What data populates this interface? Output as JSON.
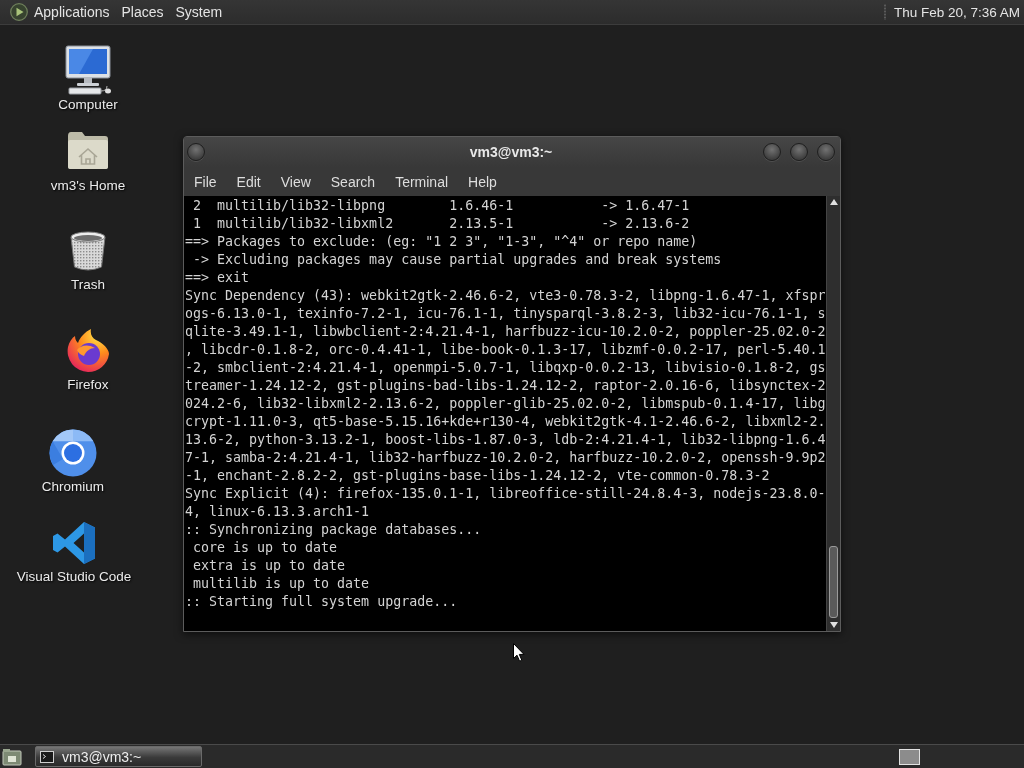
{
  "top_panel": {
    "menus": [
      "Applications",
      "Places",
      "System"
    ],
    "clock": "Thu Feb 20, 7:36 AM"
  },
  "desktop_icons": [
    {
      "kind": "computer",
      "label": "Computer"
    },
    {
      "kind": "home",
      "label": "vm3's Home"
    },
    {
      "kind": "trash",
      "label": "Trash"
    },
    {
      "kind": "firefox",
      "label": "Firefox"
    },
    {
      "kind": "chromium",
      "label": "Chromium"
    },
    {
      "kind": "vscode",
      "label": "Visual Studio Code"
    }
  ],
  "terminal_window": {
    "title": "vm3@vm3:~",
    "menu": [
      "File",
      "Edit",
      "View",
      "Search",
      "Terminal",
      "Help"
    ],
    "lines": [
      " 2  multilib/lib32-libpng        1.6.46-1           -> 1.6.47-1",
      " 1  multilib/lib32-libxml2       2.13.5-1           -> 2.13.6-2",
      "==> Packages to exclude: (eg: \"1 2 3\", \"1-3\", \"^4\" or repo name)",
      " -> Excluding packages may cause partial upgrades and break systems",
      "==> exit",
      "Sync Dependency (43): webkit2gtk-2.46.6-2, vte3-0.78.3-2, libpng-1.6.47-1, xfspr",
      "ogs-6.13.0-1, texinfo-7.2-1, icu-76.1-1, tinysparql-3.8.2-3, lib32-icu-76.1-1, s",
      "qlite-3.49.1-1, libwbclient-2:4.21.4-1, harfbuzz-icu-10.2.0-2, poppler-25.02.0-2",
      ", libcdr-0.1.8-2, orc-0.4.41-1, libe-book-0.1.3-17, libzmf-0.0.2-17, perl-5.40.1",
      "-2, smbclient-2:4.21.4-1, openmpi-5.0.7-1, libqxp-0.0.2-13, libvisio-0.1.8-2, gs",
      "treamer-1.24.12-2, gst-plugins-bad-libs-1.24.12-2, raptor-2.0.16-6, libsynctex-2",
      "024.2-6, lib32-libxml2-2.13.6-2, poppler-glib-25.02.0-2, libmspub-0.1.4-17, libg",
      "crypt-1.11.0-3, qt5-base-5.15.16+kde+r130-4, webkit2gtk-4.1-2.46.6-2, libxml2-2.",
      "13.6-2, python-3.13.2-1, boost-libs-1.87.0-3, ldb-2:4.21.4-1, lib32-libpng-1.6.4",
      "7-1, samba-2:4.21.4-1, lib32-harfbuzz-10.2.0-2, harfbuzz-10.2.0-2, openssh-9.9p2",
      "-1, enchant-2.8.2-2, gst-plugins-base-libs-1.24.12-2, vte-common-0.78.3-2",
      "Sync Explicit (4): firefox-135.0.1-1, libreoffice-still-24.8.4-3, nodejs-23.8.0-",
      "4, linux-6.13.3.arch1-1",
      ":: Synchronizing package databases...",
      " core is up to date",
      " extra is up to date",
      " multilib is up to date",
      ":: Starting full system upgrade..."
    ]
  },
  "bottom_panel": {
    "tasks": [
      {
        "label": "vm3@vm3:~",
        "selected": true
      }
    ]
  }
}
